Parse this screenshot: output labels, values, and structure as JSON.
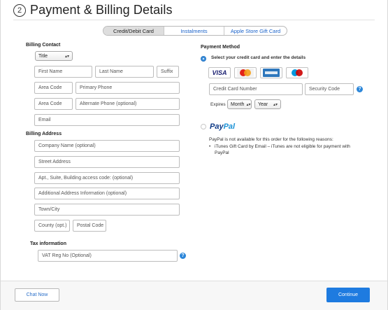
{
  "header": {
    "step_number": "2",
    "title": "Payment & Billing Details"
  },
  "tabs": [
    {
      "label": "Credit/Debit Card",
      "active": true
    },
    {
      "label": "Instalments",
      "active": false
    },
    {
      "label": "Apple Store Gift Card",
      "active": false
    }
  ],
  "billing_contact": {
    "heading": "Billing Contact",
    "title_select": "Title",
    "first_name": "First Name",
    "last_name": "Last Name",
    "suffix": "Suffix",
    "area_code_1": "Area Code",
    "primary_phone": "Primary Phone",
    "area_code_2": "Area Code",
    "alternate_phone": "Alternate Phone (optional)",
    "email": "Email"
  },
  "billing_address": {
    "heading": "Billing Address",
    "company_name": "Company Name (optional)",
    "street_address": "Street Address",
    "apt_suite": "Apt., Suite, Building access code: (optional)",
    "additional_info": "Additional Address Information (optional)",
    "town_city": "Town/City",
    "county": "County (opt.)",
    "postal_code": "Postal Code"
  },
  "tax": {
    "heading": "Tax information",
    "vat_reg": "VAT Reg No (Optional)"
  },
  "payment_method": {
    "heading": "Payment Method",
    "card_instruction": "Select your credit card and enter the details",
    "cards": [
      "VISA",
      "mastercard",
      "american-express",
      "maestro"
    ],
    "card_number": "Credit Card Number",
    "security_code": "Security Code",
    "expires_label": "Expires",
    "month_select": "Month",
    "year_select": "Year",
    "paypal_pay": "Pay",
    "paypal_pal": "Pal",
    "paypal_note": "PayPal is not available for this order for the following reasons:",
    "paypal_reason_line1": "iTunes Gift Card by Email – iTunes are not eligible for payment with",
    "paypal_reason_line2": "PayPal"
  },
  "footer": {
    "chat_label": "Chat Now",
    "continue_label": "Continue"
  },
  "colors": {
    "accent": "#1e7be0",
    "link": "#1a62c9"
  }
}
